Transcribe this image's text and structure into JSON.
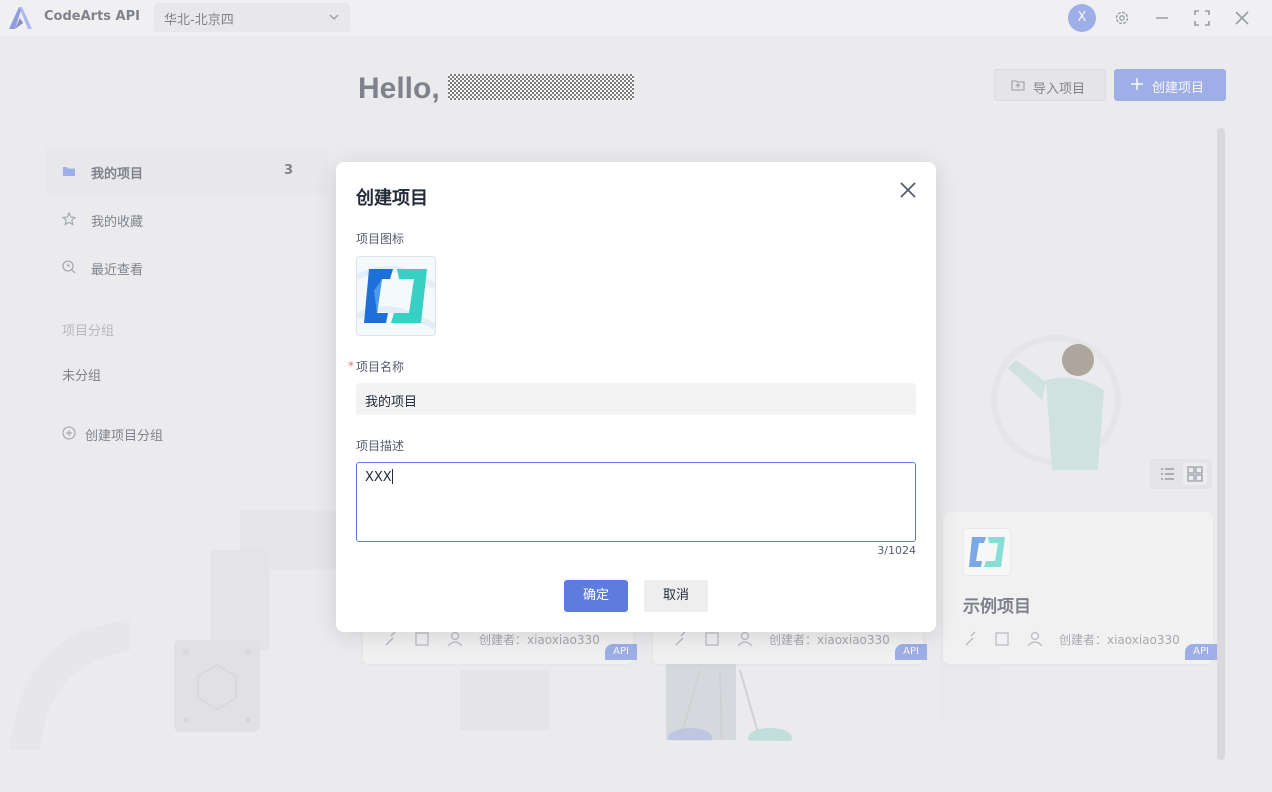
{
  "app": {
    "name": "CodeArts API",
    "region": "华北-北京四",
    "user_initial": "X"
  },
  "header": {
    "greeting": "Hello,",
    "import_label": "导入项目",
    "create_label": "创建项目"
  },
  "sidebar": {
    "items": [
      {
        "label": "我的项目",
        "count": "3",
        "active": true,
        "icon": "folder-icon"
      },
      {
        "label": "我的收藏",
        "icon": "star-icon"
      },
      {
        "label": "最近查看",
        "icon": "recent-icon"
      }
    ],
    "group_title": "项目分组",
    "ungrouped": "未分组",
    "create_group": "创建项目分组"
  },
  "cards": [
    {
      "name": "",
      "owner": "创建者：xiaoxiao330",
      "badge": "API"
    },
    {
      "name": "",
      "owner": "创建者：xiaoxiao330",
      "badge": "API"
    },
    {
      "name": "示例项目",
      "owner": "创建者：xiaoxiao330",
      "badge": "API"
    }
  ],
  "modal": {
    "title": "创建项目",
    "icon_label": "项目图标",
    "required_mark": "*",
    "name_label": "项目名称",
    "name_value": "我的项目",
    "desc_label": "项目描述",
    "desc_value": "XXX",
    "char_count": "3/1024",
    "ok_label": "确定",
    "cancel_label": "取消"
  },
  "colors": {
    "accent": "#5e7ce0",
    "required": "#f66f6a"
  }
}
